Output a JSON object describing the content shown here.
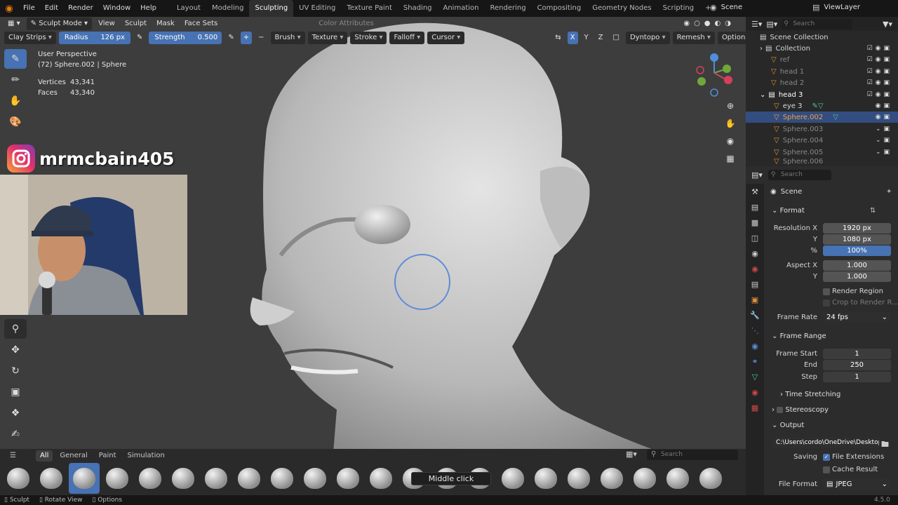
{
  "menu": {
    "file": "File",
    "edit": "Edit",
    "render": "Render",
    "window": "Window",
    "help": "Help"
  },
  "workspaces": [
    "Layout",
    "Modeling",
    "Sculpting",
    "UV Editing",
    "Texture Paint",
    "Shading",
    "Animation",
    "Rendering",
    "Compositing",
    "Geometry Nodes",
    "Scripting"
  ],
  "top_right": {
    "scene": "Scene",
    "view_layer": "ViewLayer"
  },
  "header1": {
    "mode": "Sculpt Mode",
    "view": "View",
    "sculpt": "Sculpt",
    "mask": "Mask",
    "face_sets": "Face Sets",
    "color_attributes": "Color Attributes"
  },
  "header2": {
    "brush_name": "Clay Strips",
    "radius_label": "Radius",
    "radius_value": "126 px",
    "strength_label": "Strength",
    "strength_value": "0.500",
    "brush": "Brush",
    "texture": "Texture",
    "stroke": "Stroke",
    "falloff": "Falloff",
    "cursor": "Cursor",
    "x": "X",
    "y": "Y",
    "z": "Z",
    "dyntopo": "Dyntopo",
    "remesh": "Remesh",
    "options": "Options"
  },
  "viewport_info": {
    "perspective": "User Perspective",
    "object": "(72) Sphere.002 | Sphere",
    "vertices_label": "Vertices",
    "vertices_value": "43,341",
    "faces_label": "Faces",
    "faces_value": "43,340"
  },
  "overlay": {
    "instagram_handle": "mrmcbain405"
  },
  "asset_shelf": {
    "tabs": [
      "All",
      "General",
      "Paint",
      "Simulation"
    ],
    "search_placeholder": "Search"
  },
  "tooltip": "Middle click",
  "statusbar": {
    "sculpt": "Sculpt",
    "rotate": "Rotate View",
    "options": "Options",
    "version": "4.5.0"
  },
  "outliner": {
    "search_placeholder": "Search",
    "rows": [
      {
        "name": "Scene Collection"
      },
      {
        "name": "Collection"
      },
      {
        "name": "ref"
      },
      {
        "name": "head 1"
      },
      {
        "name": "head 2"
      },
      {
        "name": "head 3"
      },
      {
        "name": "eye 3"
      },
      {
        "name": "Sphere.002"
      },
      {
        "name": "Sphere.003"
      },
      {
        "name": "Sphere.004"
      },
      {
        "name": "Sphere.005"
      },
      {
        "name": "Sphere.006"
      }
    ]
  },
  "properties": {
    "search_placeholder": "Search",
    "scene": "Scene",
    "format": "Format",
    "res_x_label": "Resolution X",
    "res_x": "1920 px",
    "res_y_label": "Y",
    "res_y": "1080 px",
    "pct_label": "%",
    "pct": "100%",
    "aspect_x_label": "Aspect X",
    "aspect_x": "1.000",
    "aspect_y_label": "Y",
    "aspect_y": "1.000",
    "render_region": "Render Region",
    "crop": "Crop to Render R...",
    "frame_rate_label": "Frame Rate",
    "frame_rate": "24 fps",
    "frame_range": "Frame Range",
    "frame_start_label": "Frame Start",
    "frame_start": "1",
    "end_label": "End",
    "end": "250",
    "step_label": "Step",
    "step": "1",
    "time_stretching": "Time Stretching",
    "stereoscopy": "Stereoscopy",
    "output": "Output",
    "output_path": "C:\\Users\\cordo\\OneDrive\\Desktop\\",
    "saving_label": "Saving",
    "file_extensions": "File Extensions",
    "cache_result": "Cache Result",
    "file_format_label": "File Format",
    "file_format": "JPEG"
  }
}
